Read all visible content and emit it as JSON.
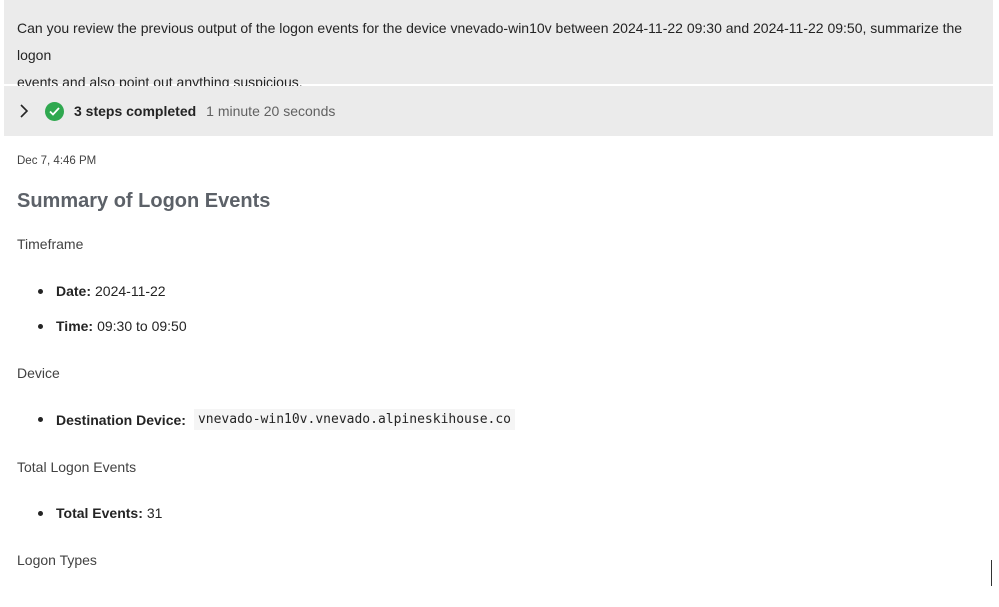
{
  "prompt": {
    "line1": "Can you review the previous output of the logon events for the device vnevado-win10v between 2024-11-22 09:30 and 2024-11-22 09:50, summarize the logon",
    "line2": "events and also point out anything suspicious."
  },
  "steps": {
    "label": "3 steps completed",
    "duration": "1 minute 20 seconds",
    "status_color": "#2fa84f"
  },
  "response": {
    "timestamp": "Dec 7, 4:46 PM",
    "heading": "Summary of Logon Events",
    "timeframe": {
      "title": "Timeframe",
      "date_label": "Date:",
      "date_value": "2024-11-22",
      "time_label": "Time:",
      "time_value": "09:30 to 09:50"
    },
    "device": {
      "title": "Device",
      "dest_label": "Destination Device:",
      "dest_value": "vnevado-win10v.vnevado.alpineskihouse.co"
    },
    "total": {
      "title": "Total Logon Events",
      "label": "Total Events:",
      "value": "31"
    },
    "logon_types": {
      "title": "Logon Types"
    }
  }
}
